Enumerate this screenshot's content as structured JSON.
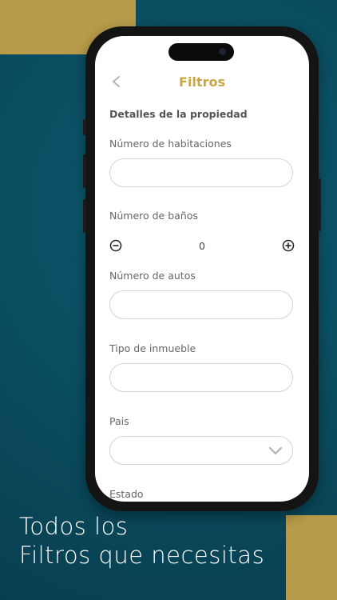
{
  "header": {
    "title": "Filtros",
    "back_icon": "chevron-left-icon"
  },
  "form": {
    "section_title": "Detalles de la propiedad",
    "habitaciones": {
      "label": "Número de habitaciones",
      "value": ""
    },
    "banos": {
      "label": "Número de baños",
      "value": "0"
    },
    "autos": {
      "label": "Número de autos",
      "value": ""
    },
    "tipo": {
      "label": "Tipo de inmueble",
      "value": ""
    },
    "pais": {
      "label": "Pais",
      "value": ""
    },
    "estado": {
      "label": "Estado"
    }
  },
  "promo": {
    "line1": "Todos los",
    "line2": "Filtros que necesitas"
  },
  "colors": {
    "accent_gold": "#c8a545",
    "background_teal": "#0a4c5f",
    "panel_gold": "#b79b4b"
  }
}
